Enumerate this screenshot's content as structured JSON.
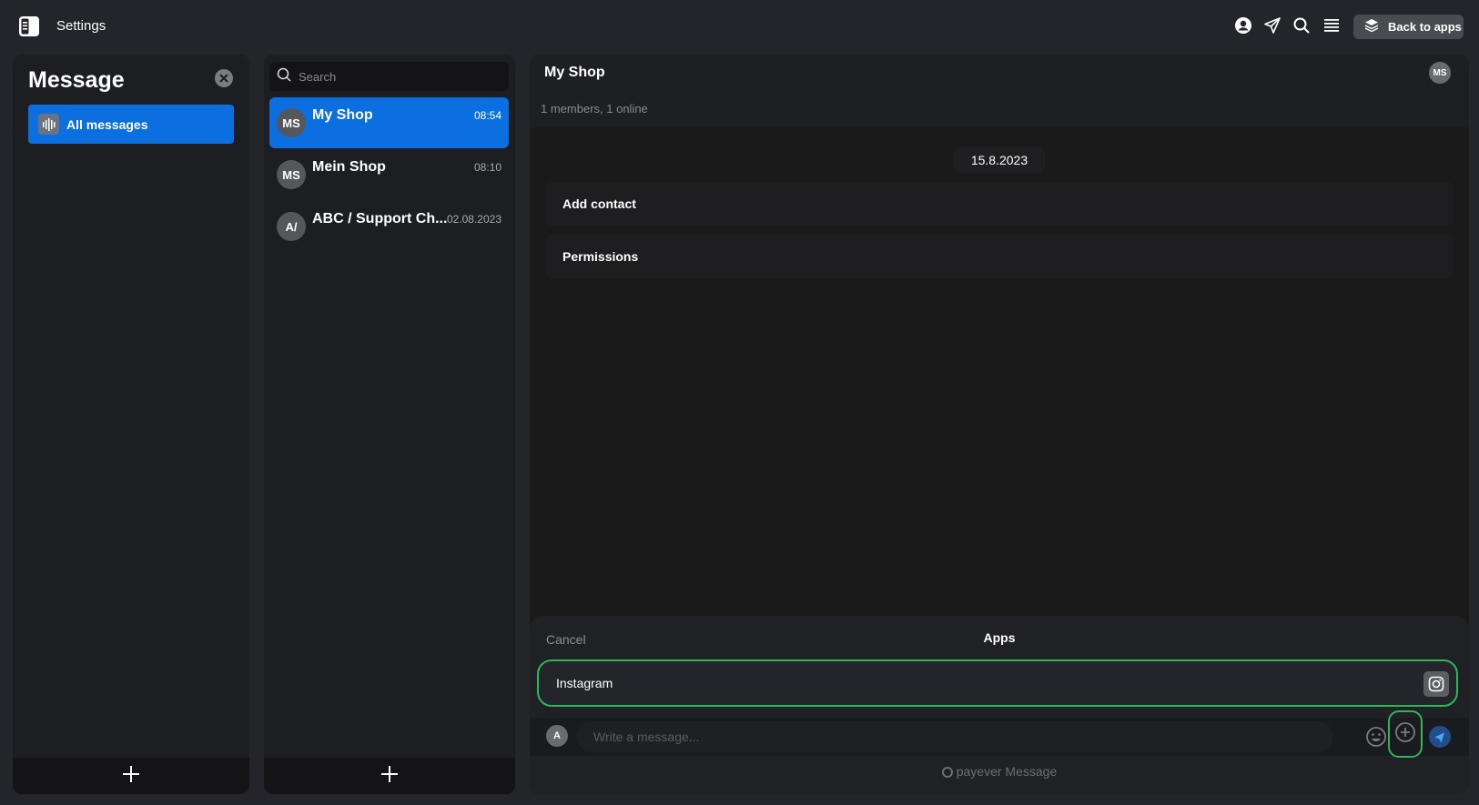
{
  "topbar": {
    "title": "Settings",
    "back_label": "Back to apps"
  },
  "sidebar": {
    "heading": "Message",
    "items": [
      {
        "label": "All messages"
      }
    ]
  },
  "search": {
    "placeholder": "Search"
  },
  "chats": [
    {
      "initials": "MS",
      "name": "My Shop",
      "time": "08:54",
      "active": true
    },
    {
      "initials": "MS",
      "name": "Mein Shop",
      "time": "08:10",
      "active": false
    },
    {
      "initials": "A/",
      "name": "ABC / Support Ch...",
      "time": "02.08.2023",
      "active": false
    }
  ],
  "conversation": {
    "name": "My Shop",
    "avatar": "MS",
    "members": "1 members, 1 online",
    "date": "15.8.2023",
    "system_rows": [
      "Add contact",
      "Permissions"
    ]
  },
  "apps_sheet": {
    "cancel": "Cancel",
    "title": "Apps",
    "items": [
      {
        "label": "Instagram"
      }
    ]
  },
  "composer": {
    "avatar": "A",
    "placeholder": "Write a message..."
  },
  "brand": "payever Message",
  "colors": {
    "accent": "#0b6fe0",
    "highlight": "#2fb55a",
    "background": "#24252a"
  }
}
